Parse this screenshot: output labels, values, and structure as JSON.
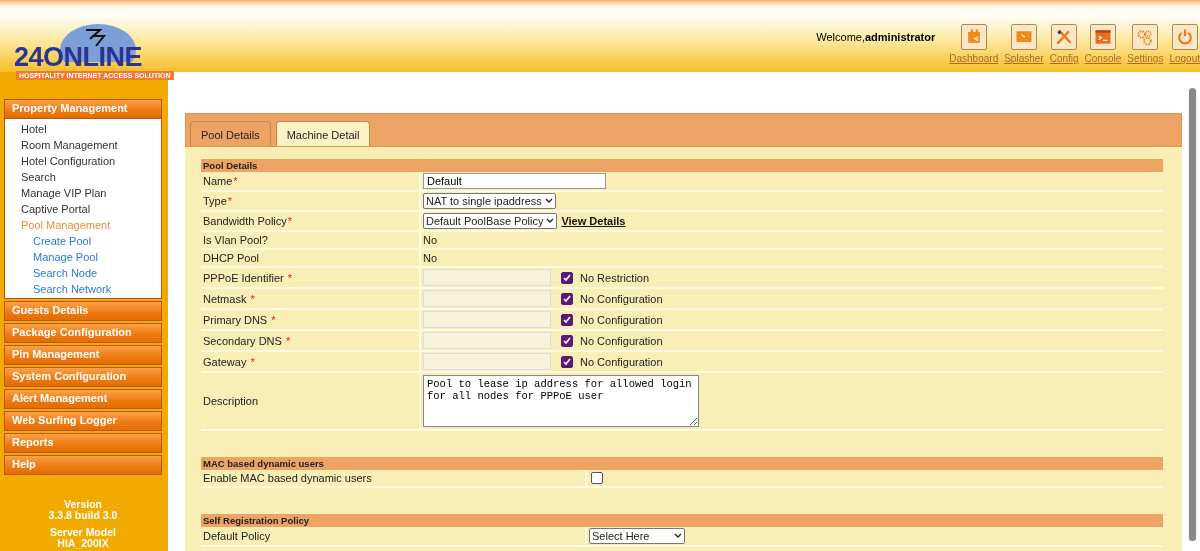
{
  "logo": {
    "name": "24ONLINE",
    "tagline": "HOSPITALITY INTERNET ACCESS SOLUTION"
  },
  "header": {
    "welcome": "Welcome,**administrator**",
    "tools": [
      {
        "label": "Dashboard",
        "kind": "dashboard"
      },
      {
        "label": "Splasher",
        "kind": "splasher"
      },
      {
        "label": "Config",
        "kind": "config"
      },
      {
        "label": "Console",
        "kind": "console"
      },
      {
        "label": "Settings",
        "kind": "settings"
      },
      {
        "label": "Logout",
        "kind": "logout"
      }
    ]
  },
  "sidebar": {
    "menus": [
      {
        "label": "Property Management",
        "expanded": true,
        "children": [
          {
            "label": "Hotel",
            "selected": false
          },
          {
            "label": "Room Management",
            "selected": false
          },
          {
            "label": "Hotel Configuration",
            "selected": false
          },
          {
            "label": "Search",
            "selected": false
          },
          {
            "label": "Manage VIP Plan",
            "selected": false
          },
          {
            "label": "Captive Portal",
            "selected": false
          },
          {
            "label": "Pool Management",
            "selected": true,
            "children": [
              {
                "label": "Create Pool",
                "selected": false
              },
              {
                "label": "Manage Pool",
                "selected": false
              },
              {
                "label": "Search Node",
                "selected": false
              },
              {
                "label": "Search Network",
                "selected": false
              }
            ]
          }
        ]
      },
      {
        "label": "Guests Details",
        "expanded": false
      },
      {
        "label": "Package Configuration",
        "expanded": false
      },
      {
        "label": "Pin Management",
        "expanded": false
      },
      {
        "label": "System Configuration",
        "expanded": false
      },
      {
        "label": "Alert Management",
        "expanded": false
      },
      {
        "label": "Web Surfing Logger",
        "expanded": false
      },
      {
        "label": "Reports",
        "expanded": false
      },
      {
        "label": "Help",
        "expanded": false
      }
    ],
    "version_label": "Version",
    "version": "3.3.8 build 3.0",
    "model_label": "Server Model",
    "model": "HIA_200IX"
  },
  "tabs": [
    {
      "label": "Pool Details",
      "selected": true
    },
    {
      "label": "Machine Detail",
      "selected": false
    }
  ],
  "sections": [
    {
      "title": "Pool Details",
      "rows": [
        {
          "kind": "input",
          "label": "Name",
          "required_mark": "*",
          "value": "Default"
        },
        {
          "kind": "select",
          "label": "Type",
          "required_mark": "*",
          "value": "NAT to single ipaddress"
        },
        {
          "kind": "select",
          "label": "Bandwidth Policy",
          "required_mark": "*",
          "value": "Default PoolBase Policy",
          "link": "View Details"
        },
        {
          "kind": "static",
          "label": "Is Vlan Pool?",
          "value": "No"
        },
        {
          "kind": "static",
          "label": "DHCP Pool",
          "value": "No"
        },
        {
          "kind": "option",
          "label": "PPPoE Identifier",
          "required_mark": "*",
          "checked": true,
          "option": "No Restriction"
        },
        {
          "kind": "option",
          "label": "Netmask",
          "required_mark": "*",
          "checked": true,
          "option": "No Configuration"
        },
        {
          "kind": "option",
          "label": "Primary DNS",
          "required_mark": "*",
          "checked": true,
          "option": "No Configuration"
        },
        {
          "kind": "option",
          "label": "Secondary DNS",
          "required_mark": "*",
          "checked": true,
          "option": "No Configuration"
        },
        {
          "kind": "option",
          "label": "Gateway",
          "required_mark": "*",
          "checked": true,
          "option": "No Configuration"
        },
        {
          "kind": "textarea",
          "label": "Description",
          "value": "Pool to lease ip address for allowed login for all nodes for PPPoE user"
        }
      ]
    },
    {
      "title": "MAC based dynamic users",
      "rows": [
        {
          "kind": "checkbox",
          "label": "Enable MAC based dynamic users",
          "checked": false
        }
      ]
    },
    {
      "title": "Self Registration Policy",
      "rows": [
        {
          "kind": "select",
          "label": "Default Policy",
          "value": "Select Here"
        }
      ]
    }
  ]
}
